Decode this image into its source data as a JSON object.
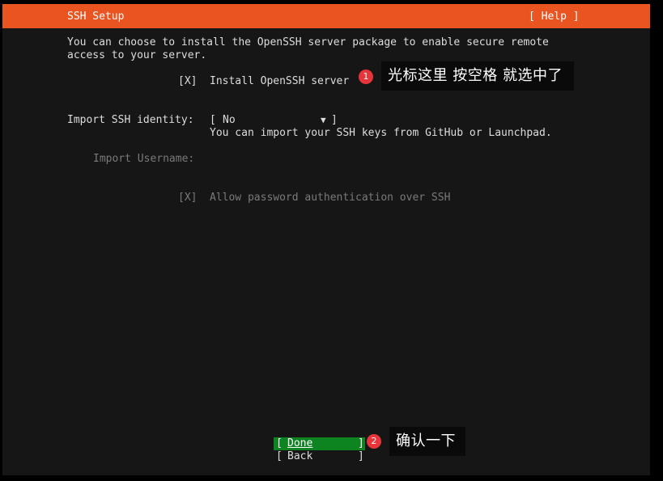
{
  "header": {
    "title": "SSH Setup",
    "help_label": "[ Help ]",
    "color": "#e95420"
  },
  "intro": {
    "line1": "You can choose to install the OpenSSH server package to enable secure remote",
    "line2": "access to your server."
  },
  "install_openssh": {
    "checkbox": "[X]",
    "label": "Install OpenSSH server"
  },
  "import_identity": {
    "label": "Import SSH identity:",
    "bracket_open": "[",
    "value": "No",
    "arrow": "▼",
    "bracket_close": "]",
    "help": "You can import your SSH keys from GitHub or Launchpad."
  },
  "import_username": {
    "label": "Import Username:"
  },
  "allow_password": {
    "checkbox": "[X]",
    "label": "Allow password authentication over SSH"
  },
  "buttons": {
    "done": {
      "open": "[",
      "label": "Done",
      "close": "]",
      "color": "#0e8420"
    },
    "back": {
      "open": "[",
      "label": "Back",
      "close": "]"
    }
  },
  "annotations": [
    {
      "number": "1",
      "text": "光标这里 按空格 就选中了"
    },
    {
      "number": "2",
      "text": "确认一下"
    }
  ]
}
